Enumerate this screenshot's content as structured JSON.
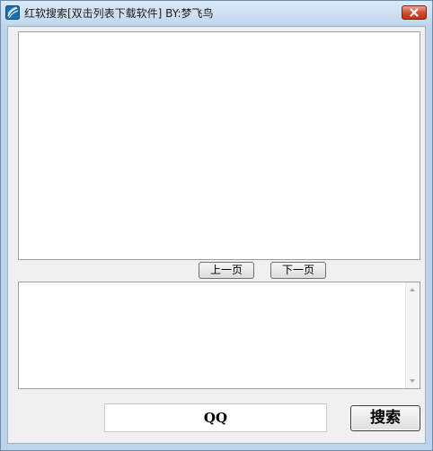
{
  "window": {
    "title": "红软搜索[双击列表下载软件]  BY:梦飞鸟"
  },
  "pager": {
    "prev_label": "上一页",
    "next_label": "下一页"
  },
  "search": {
    "value": "QQ",
    "button_label": "搜索"
  },
  "icons": {
    "app": "app-logo-icon",
    "close": "close-icon",
    "scroll_up": "scroll-up-arrow-icon",
    "scroll_down": "scroll-down-arrow-icon"
  },
  "colors": {
    "titlebar": "#c3d8ee",
    "close_button": "#c13316",
    "client_background": "#f0f0f0"
  }
}
